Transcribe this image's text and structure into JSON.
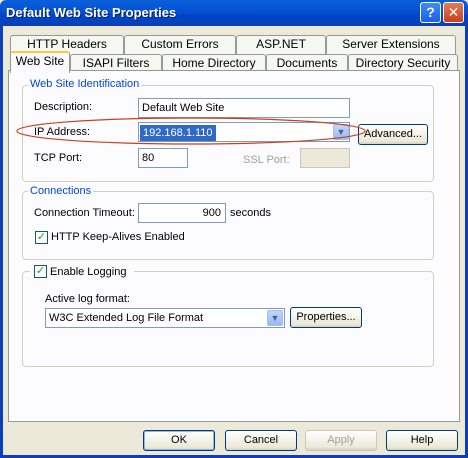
{
  "window": {
    "title": "Default Web Site Properties",
    "help_glyph": "?",
    "close_glyph": "✕"
  },
  "tabs_row1": [
    "HTTP Headers",
    "Custom Errors",
    "ASP.NET",
    "Server Extensions"
  ],
  "tabs_row2": [
    "Web Site",
    "ISAPI Filters",
    "Home Directory",
    "Documents",
    "Directory Security"
  ],
  "active_tab": "Web Site",
  "identification": {
    "group_title": "Web Site Identification",
    "description_label": "Description:",
    "description_value": "Default Web Site",
    "ip_label": "IP Address:",
    "ip_value": "192.168.1.110",
    "advanced_button": "Advanced...",
    "tcp_label": "TCP Port:",
    "tcp_value": "80",
    "ssl_label": "SSL Port:",
    "ssl_value": ""
  },
  "connections": {
    "group_title": "Connections",
    "timeout_label": "Connection Timeout:",
    "timeout_value": "900",
    "timeout_unit": "seconds",
    "keepalive_label": "HTTP Keep-Alives Enabled",
    "keepalive_checked": true
  },
  "logging": {
    "enable_label": "Enable Logging",
    "enable_checked": true,
    "format_label": "Active log format:",
    "format_value": "W3C Extended Log File Format",
    "properties_button": "Properties..."
  },
  "footer": {
    "ok": "OK",
    "cancel": "Cancel",
    "apply": "Apply",
    "help": "Help"
  },
  "colors": {
    "titlebar": "#0453d4",
    "highlight_ellipse": "#c8411e",
    "ip_highlight": "#316ac5",
    "group_title": "#0046d5"
  }
}
